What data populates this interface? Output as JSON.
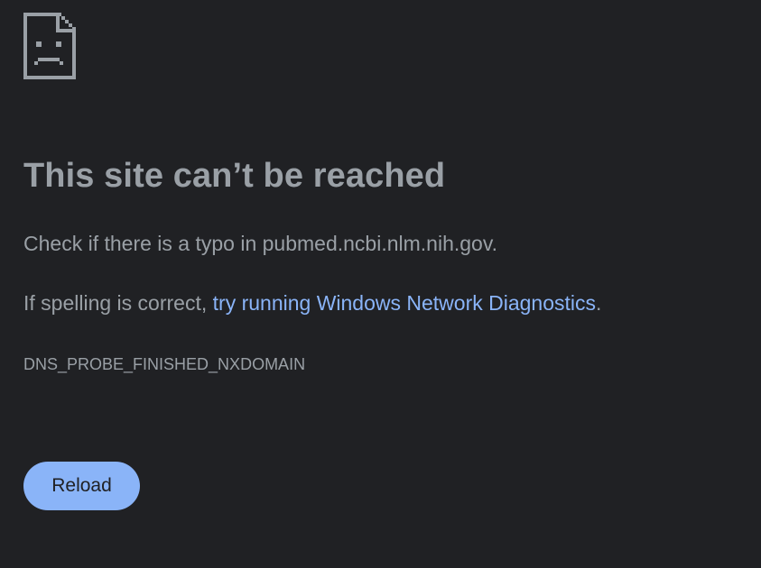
{
  "error_page": {
    "icon": "sad-page-icon",
    "title": "This site can’t be reached",
    "check_text": "Check if there is a typo in pubmed.ncbi.nlm.nih.gov.",
    "spelling_prefix": "If spelling is correct, ",
    "diagnostics_link": "try running Windows Network Diagnostics",
    "spelling_suffix": ".",
    "error_code": "DNS_PROBE_FINISHED_NXDOMAIN",
    "reload_label": "Reload"
  },
  "colors": {
    "background": "#202124",
    "text": "#9aa0a6",
    "link": "#8ab4f8",
    "button": "#8ab4f8",
    "button_text": "#202124"
  }
}
